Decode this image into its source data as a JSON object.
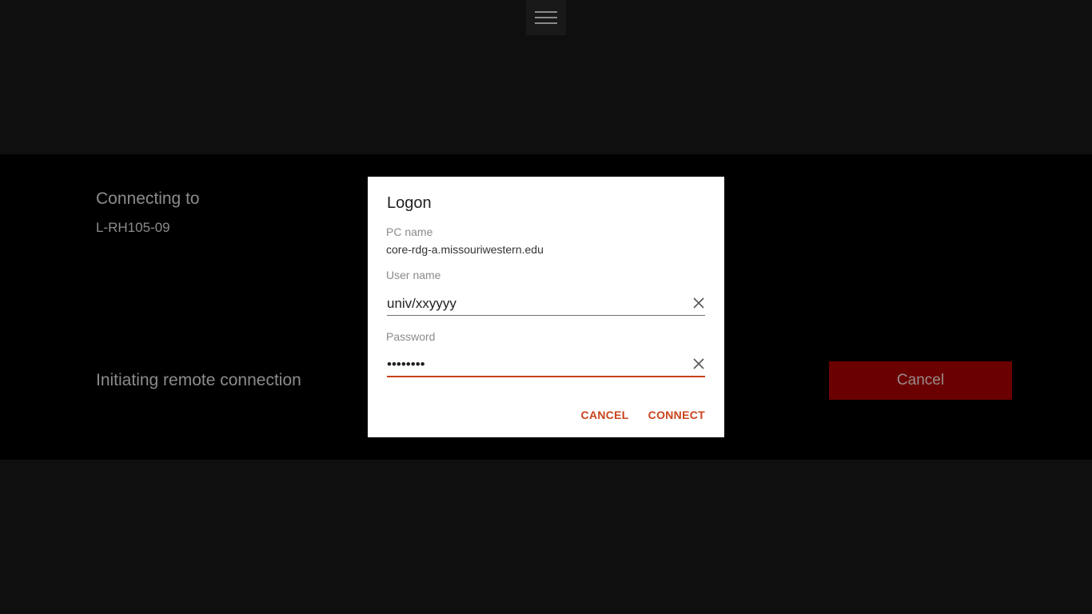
{
  "background": {
    "connecting_label": "Connecting to",
    "pc_target": "L-RH105-09",
    "status_text": "Initiating remote connection",
    "cancel_label": "Cancel"
  },
  "menu": {
    "icon": "hamburger-menu-icon"
  },
  "dialog": {
    "title": "Logon",
    "pc_name_label": "PC name",
    "pc_name_value": "core-rdg-a.missouriwestern.edu",
    "username_label": "User name",
    "username_value": "univ/xxyyyy",
    "password_label": "Password",
    "password_value": "••••••••",
    "cancel_label": "CANCEL",
    "connect_label": "CONNECT"
  },
  "colors": {
    "accent": "#c8431b",
    "cancel_bg": "#6b0000",
    "band_bg": "#000000",
    "page_bg": "#0f0f0f"
  }
}
